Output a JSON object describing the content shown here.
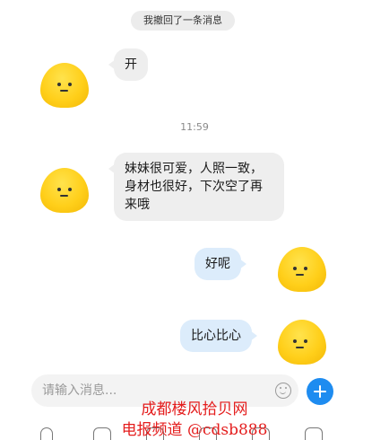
{
  "notice": "我撤回了一条消息",
  "time": "11:59",
  "messages": [
    {
      "side": "left",
      "text": "开"
    },
    {
      "side": "left",
      "text": "妹妹很可爱，人照一致，\n身材也很好，下次空了再\n来哦"
    },
    {
      "side": "right",
      "text": "好呢"
    },
    {
      "side": "right",
      "text": "比心比心"
    }
  ],
  "input": {
    "placeholder": "请输入消息..."
  },
  "icons": [
    "smiley-icon",
    "plus-icon",
    "mic-icon",
    "image-icon",
    "camera-icon",
    "video-icon"
  ],
  "accent": "#1e8cf0",
  "watermark": {
    "line1": "成都楼风拾贝网",
    "line2": "电报频道 @cdsb888"
  }
}
